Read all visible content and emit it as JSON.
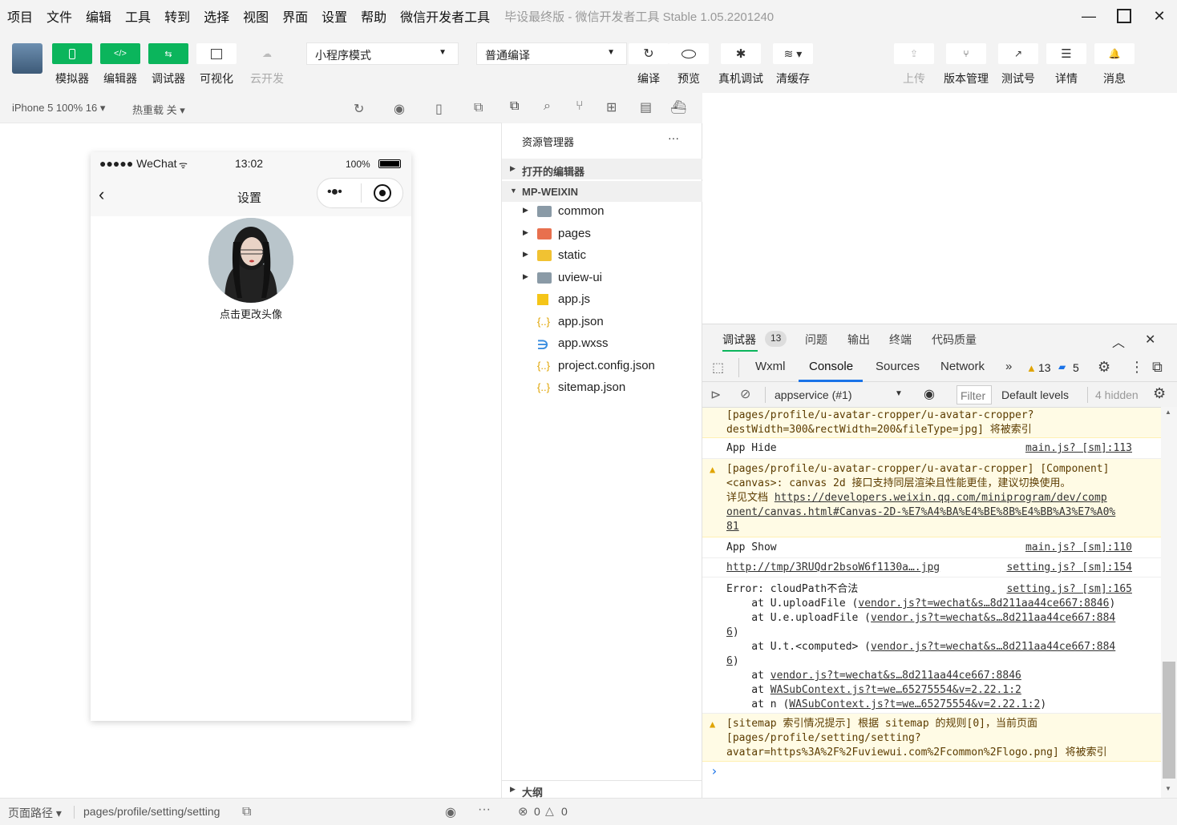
{
  "menubar": {
    "items": [
      "项目",
      "文件",
      "编辑",
      "工具",
      "转到",
      "选择",
      "视图",
      "界面",
      "设置",
      "帮助",
      "微信开发者工具"
    ],
    "window_title": "毕设最终版 - 微信开发者工具 Stable 1.05.2201240"
  },
  "toolbar": {
    "simulator_label": "模拟器",
    "editor_label": "编辑器",
    "debugger_label": "调试器",
    "visual_label": "可视化",
    "cloud_label": "云开发",
    "mode_select": "小程序模式",
    "compile_select": "普通编译",
    "compile_label": "编译",
    "preview_label": "预览",
    "remote_debug_label": "真机调试",
    "clear_cache_label": "清缓存",
    "upload_label": "上传",
    "version_label": "版本管理",
    "test_label": "测试号",
    "detail_label": "详情",
    "message_label": "消息"
  },
  "simulator": {
    "device": "iPhone 5 100% 16 ▾",
    "hot_reload": "热重载 关 ▾",
    "carrier": "●●●●● WeChat",
    "time": "13:02",
    "battery": "100%",
    "nav_title": "设置",
    "avatar_caption": "点击更改头像"
  },
  "explorer": {
    "title": "资源管理器",
    "more": "···",
    "open_editors": "打开的编辑器",
    "project": "MP-WEIXIN",
    "tree": [
      {
        "name": "common",
        "type": "folder"
      },
      {
        "name": "pages",
        "type": "folder-red"
      },
      {
        "name": "static",
        "type": "folder-yellow"
      },
      {
        "name": "uview-ui",
        "type": "folder"
      },
      {
        "name": "app.js",
        "type": "js"
      },
      {
        "name": "app.json",
        "type": "json"
      },
      {
        "name": "app.wxss",
        "type": "css"
      },
      {
        "name": "project.config.json",
        "type": "json"
      },
      {
        "name": "sitemap.json",
        "type": "json"
      }
    ],
    "outline": "大纲"
  },
  "devtools": {
    "tab_debugger": "调试器",
    "tab_debugger_count": "13",
    "tab_issues": "问题",
    "tab_output": "输出",
    "tab_terminal": "终端",
    "tab_quality": "代码质量",
    "tab_wxml": "Wxml",
    "tab_console": "Console",
    "tab_sources": "Sources",
    "tab_network": "Network",
    "more_tabs": "»",
    "warn_count": "13",
    "info_count": "5",
    "context": "appservice (#1)",
    "filter_placeholder": "Filter",
    "levels": "Default levels",
    "hidden": "4 hidden"
  },
  "console": {
    "m1_l1": "[pages/profile/u-avatar-cropper/u-avatar-cropper?",
    "m1_l2": "destWidth=300&rectWidth=200&fileType=jpg] 将被索引",
    "m2_text": "App Hide",
    "m2_src": "main.js? [sm]:113",
    "m3_l1": "[pages/profile/u-avatar-cropper/u-avatar-cropper] [Component]",
    "m3_l2": "<canvas>: canvas 2d 接口支持同层渲染且性能更佳，建议切换使用。",
    "m3_l3a": "详见文档 ",
    "m3_l3b": "https://developers.weixin.qq.com/miniprogram/dev/comp",
    "m3_l4": "onent/canvas.html#Canvas-2D-%E7%A4%BA%E4%BE%8B%E4%BB%A3%E7%A0%",
    "m3_l5": "81",
    "m4_text": "App Show",
    "m4_src": "main.js? [sm]:110",
    "m5_text": "http://tmp/3RUQdr2bsoW6f1130a….jpg",
    "m5_src": "setting.js? [sm]:154",
    "m6_l1": "Error: cloudPath不合法",
    "m6_src": "setting.js? [sm]:165",
    "m6_l2a": "    at U.uploadFile (",
    "m6_l2b": "vendor.js?t=wechat&s…8d211aa44ce667:8846",
    "m6_l2c": ")",
    "m6_l3a": "    at U.e.uploadFile (",
    "m6_l3b": "vendor.js?t=wechat&s…8d211aa44ce667:884",
    "m6_l4": "6",
    "m6_l4c": ")",
    "m6_l5a": "    at U.t.<computed> (",
    "m6_l5b": "vendor.js?t=wechat&s…8d211aa44ce667:884",
    "m6_l6": "6",
    "m6_l6c": ")",
    "m6_l7a": "    at ",
    "m6_l7b": "vendor.js?t=wechat&s…8d211aa44ce667:8846",
    "m6_l8a": "    at ",
    "m6_l8b": "WASubContext.js?t=we…65275554&v=2.22.1:2",
    "m6_l9a": "    at n (",
    "m6_l9b": "WASubContext.js?t=we…65275554&v=2.22.1:2",
    "m6_l9c": ")",
    "m7_l1": "[sitemap 索引情况提示] 根据 sitemap 的规则[0]，当前页面",
    "m7_l2": "[pages/profile/setting/setting?",
    "m7_l3": "avatar=https%3A%2F%2Fuviewui.com%2Fcommon%2Flogo.png] 将被索引",
    "prompt": "›"
  },
  "statusbar": {
    "page_path_label": "页面路径 ▾",
    "page_path": "pages/profile/setting/setting",
    "errors": "0",
    "warnings": "0"
  }
}
